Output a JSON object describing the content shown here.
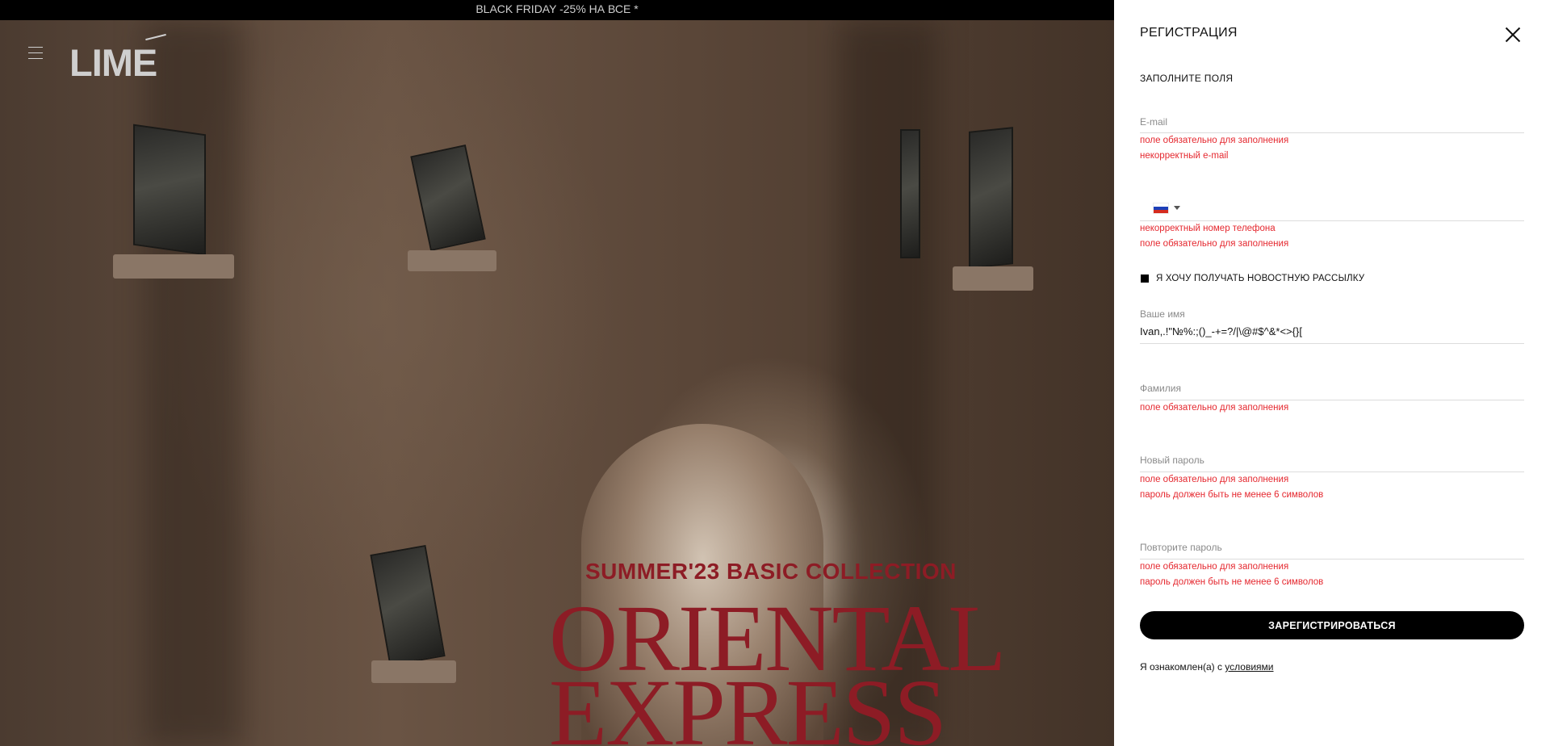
{
  "banner": {
    "text": "BLACK FRIDAY -25% НА ВСЕ *"
  },
  "header": {
    "logo": "LIME"
  },
  "hero": {
    "collection": "SUMMER'23 BASIC COLLECTION",
    "title_line1": "ORIENTAL",
    "title_line2": "EXPRESS"
  },
  "registration": {
    "title": "РЕГИСТРАЦИЯ",
    "subtitle": "ЗАПОЛНИТЕ ПОЛЯ",
    "email": {
      "label": "E-mail",
      "value": "",
      "errors": [
        "поле обязательно для заполнения",
        "некорректный e-mail"
      ]
    },
    "phone": {
      "country": "RU",
      "value": "",
      "errors": [
        "некорректный номер телефона",
        "поле обязательно для заполнения"
      ]
    },
    "newsletter": {
      "label": "Я ХОЧУ ПОЛУЧАТЬ НОВОСТНУЮ РАССЫЛКУ",
      "checked": true
    },
    "first_name": {
      "label": "Ваше имя",
      "value": "Ivan,.!\"№%:;()_-+=?/|\\@#$^&*<>{}["
    },
    "last_name": {
      "label": "Фамилия",
      "value": "",
      "errors": [
        "поле обязательно для заполнения"
      ]
    },
    "password": {
      "label": "Новый пароль",
      "value": "",
      "errors": [
        "поле обязательно для заполнения",
        "пароль должен быть не менее 6 символов"
      ]
    },
    "password_repeat": {
      "label": "Повторите пароль",
      "value": "",
      "errors": [
        "поле обязательно для заполнения",
        "пароль должен быть не менее 6 символов"
      ]
    },
    "submit_label": "ЗАРЕГИСТРИРОВАТЬСЯ",
    "terms_prefix": "Я ознакомлен(а) с ",
    "terms_link": "условиями"
  },
  "colors": {
    "error": "#e5282f",
    "hero_accent": "#8d1c25",
    "button": "#000000"
  },
  "icons": [
    "burger-menu-icon",
    "close-icon",
    "russia-flag-icon",
    "chevron-down-icon",
    "checkbox-checked-icon"
  ]
}
